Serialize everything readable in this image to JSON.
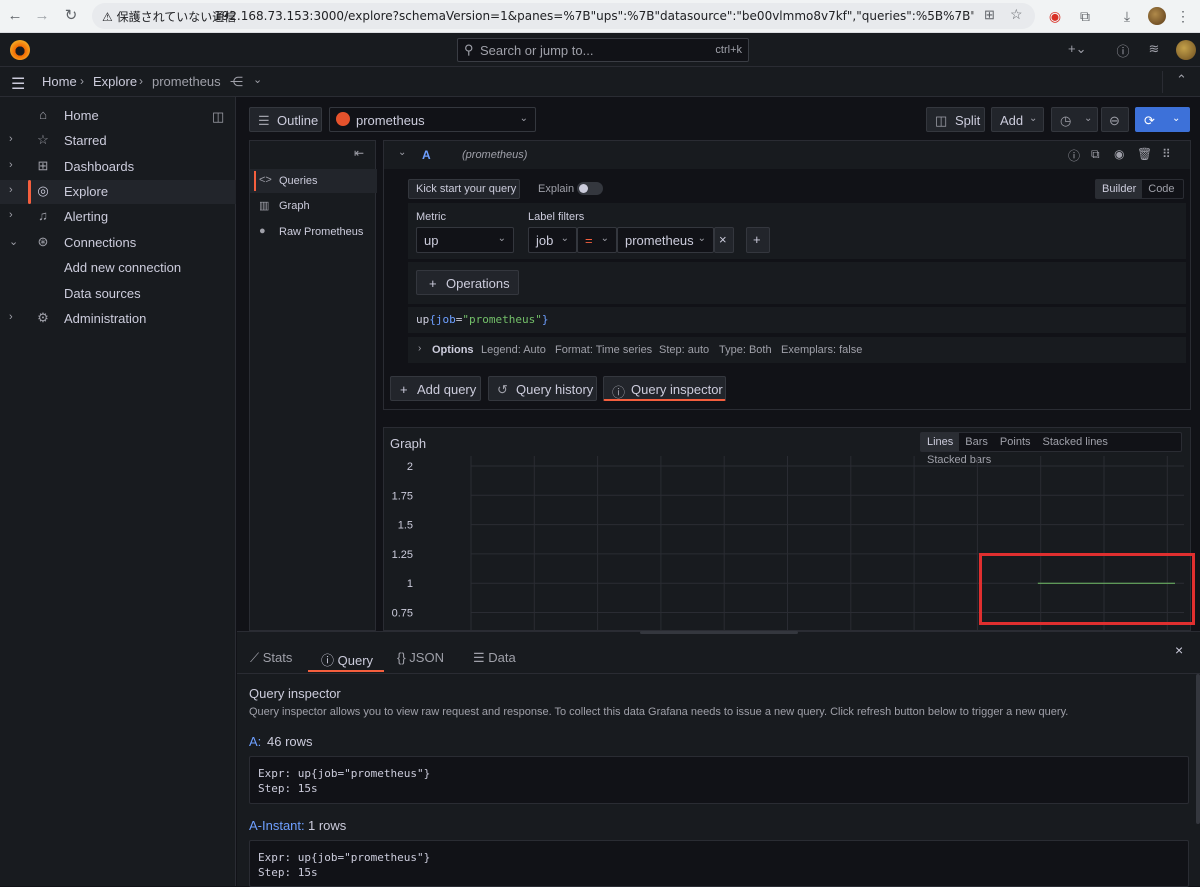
{
  "browser": {
    "security_warning": "⚠ 保護されていない通信",
    "url": "192.168.73.153:3000/explore?schemaVersion=1&panes=%7B\"ups\":%7B\"datasource\":\"be00vlmmo8v7kf\",\"queries\":%5B%7B\"refId\":\"A\",\"expr\":\"up%7Bjob%..."
  },
  "topbar": {
    "search_placeholder": "Search or jump to...",
    "search_shortcut": "ctrl+k"
  },
  "breadcrumb": [
    "Home",
    "Explore",
    "prometheus"
  ],
  "sidebar": {
    "items": [
      {
        "label": "Home",
        "icon": "home-icon",
        "chevron": ""
      },
      {
        "label": "Starred",
        "icon": "star-icon",
        "chevron": "›"
      },
      {
        "label": "Dashboards",
        "icon": "apps-icon",
        "chevron": "›"
      },
      {
        "label": "Explore",
        "icon": "compass-icon",
        "chevron": "›"
      },
      {
        "label": "Alerting",
        "icon": "bell-icon",
        "chevron": "›"
      },
      {
        "label": "Connections",
        "icon": "connections-icon",
        "chevron": "⌄"
      },
      {
        "label": "Add new connection",
        "icon": "",
        "chevron": ""
      },
      {
        "label": "Data sources",
        "icon": "",
        "chevron": ""
      },
      {
        "label": "Administration",
        "icon": "cog-icon",
        "chevron": "›"
      }
    ]
  },
  "toolbar": {
    "outline": "Outline",
    "datasource": "prometheus",
    "split": "Split",
    "add": "Add"
  },
  "outline": {
    "items": [
      "Queries",
      "Graph",
      "Raw Prometheus"
    ]
  },
  "query": {
    "refid": "A",
    "datasource_hint": "(prometheus)",
    "kick_start": "Kick start your query",
    "explain": "Explain",
    "mode_builder": "Builder",
    "mode_code": "Code",
    "metric_label": "Metric",
    "metric_value": "up",
    "label_filters_label": "Label filters",
    "filter_key": "job",
    "filter_op": "=",
    "filter_value": "prometheus",
    "operations": "Operations",
    "expr_name": "up",
    "expr_brace_open": "{",
    "expr_key": "job",
    "expr_eq": "=",
    "expr_val": "\"prometheus\"",
    "expr_brace_close": "}",
    "options_label": "Options",
    "options_summary": [
      "Legend: Auto",
      "Format: Time series",
      "Step: auto",
      "Type: Both",
      "Exemplars: false"
    ],
    "add_query": "Add query",
    "query_history": "Query history",
    "query_inspector": "Query inspector"
  },
  "graph": {
    "title": "Graph",
    "styles": [
      "Lines",
      "Bars",
      "Points",
      "Stacked lines",
      "Stacked bars"
    ],
    "active_style": "Lines"
  },
  "chart_data": {
    "type": "line",
    "title": "Graph",
    "y_ticks": [
      "2",
      "1.75",
      "1.5",
      "1.25",
      "1",
      "0.75"
    ],
    "ylim": [
      0.75,
      2
    ],
    "series": [
      {
        "values": [
          1,
          1
        ]
      }
    ],
    "series_start_fraction": 0.795,
    "series_color": "#73bf69",
    "grid": true
  },
  "inspector": {
    "tabs": [
      "Stats",
      "Query",
      "JSON",
      "Data"
    ],
    "active_tab": "Query",
    "heading": "Query inspector",
    "description": "Query inspector allows you to view raw request and response. To collect this data Grafana needs to issue a new query. Click refresh button below to trigger a new query.",
    "results": [
      {
        "ref": "A:",
        "rows": "46 rows",
        "expr": "Expr: up{job=\"prometheus\"}",
        "step": "Step: 15s"
      },
      {
        "ref": "A-Instant:",
        "rows": "1 rows",
        "expr": "Expr: up{job=\"prometheus\"}",
        "step": "Step: 15s"
      }
    ]
  },
  "colors": {
    "accent": "#f55f3e",
    "primary": "#3d71d9",
    "highlight_box": "#e02f2f"
  }
}
